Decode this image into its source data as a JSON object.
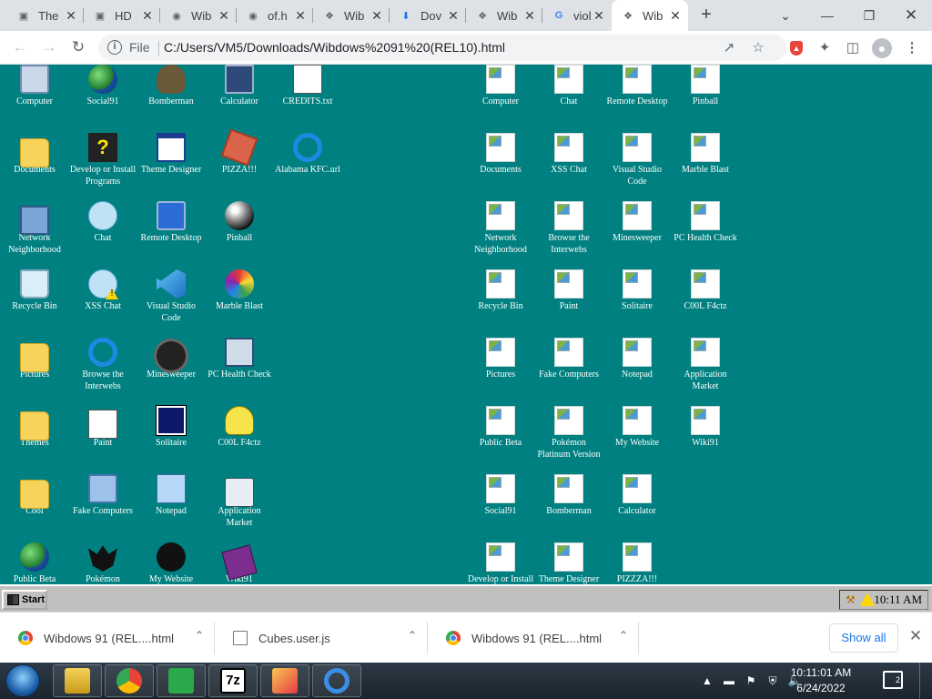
{
  "browser": {
    "tabs": [
      {
        "title": "The",
        "favicon": "film-icon"
      },
      {
        "title": "HD",
        "favicon": "film-icon"
      },
      {
        "title": "Wib",
        "favicon": "globe-icon"
      },
      {
        "title": "of.h",
        "favicon": "globe-icon"
      },
      {
        "title": "Wib",
        "favicon": "wibdows-icon"
      },
      {
        "title": "Dov",
        "favicon": "download-icon"
      },
      {
        "title": "Wib",
        "favicon": "wibdows-icon"
      },
      {
        "title": "viol",
        "favicon": "google-icon"
      },
      {
        "title": "Wib",
        "favicon": "wibdows-icon",
        "active": true
      }
    ],
    "file_label": "File",
    "url": "C:/Users/VM5/Downloads/Wibdows%2091%20(REL10).html"
  },
  "desktop": {
    "background": "#008080",
    "icons_left": [
      {
        "label": "Computer",
        "glyph": "pc"
      },
      {
        "label": "Social91",
        "glyph": "globe"
      },
      {
        "label": "Bomberman",
        "glyph": "bomber"
      },
      {
        "label": "Calculator",
        "glyph": "calc"
      },
      {
        "label": "CREDITS.txt",
        "glyph": "doc"
      },
      {
        "label": "Documents",
        "glyph": "folder"
      },
      {
        "label": "Develop or Install Programs",
        "glyph": "help"
      },
      {
        "label": "Theme Designer",
        "glyph": "win"
      },
      {
        "label": "PIZZA!!!",
        "glyph": "pizza"
      },
      {
        "label": "Alabama KFC.url",
        "glyph": "ie"
      },
      {
        "label": "Network Neighborhood",
        "glyph": "net"
      },
      {
        "label": "Chat",
        "glyph": "bubble"
      },
      {
        "label": "Remote Desktop",
        "glyph": "remote"
      },
      {
        "label": "Pinball",
        "glyph": "ball"
      },
      {
        "label": "Recycle Bin",
        "glyph": "bin"
      },
      {
        "label": "XSS Chat",
        "glyph": "xss"
      },
      {
        "label": "Visual Studio Code",
        "glyph": "vscode"
      },
      {
        "label": "Marble Blast",
        "glyph": "rainbow"
      },
      {
        "label": "Pictures",
        "glyph": "folder"
      },
      {
        "label": "Browse the Interwebs",
        "glyph": "ie"
      },
      {
        "label": "Minesweeper",
        "glyph": "mine"
      },
      {
        "label": "PC Health Check",
        "glyph": "pchealth"
      },
      {
        "label": "Themes",
        "glyph": "folder"
      },
      {
        "label": "Paint",
        "glyph": "paint"
      },
      {
        "label": "Solitaire",
        "glyph": "cards"
      },
      {
        "label": "C00L F4ctz",
        "glyph": "yellow"
      },
      {
        "label": "Cool",
        "glyph": "folder"
      },
      {
        "label": "Fake Computers",
        "glyph": "fakepc"
      },
      {
        "label": "Notepad",
        "glyph": "note"
      },
      {
        "label": "Application Market",
        "glyph": "bag"
      },
      {
        "label": "Public Beta",
        "glyph": "globe"
      },
      {
        "label": "Pokémon Platinum",
        "glyph": "bat"
      },
      {
        "label": "My Website",
        "glyph": "octo"
      },
      {
        "label": "Wiki91",
        "glyph": "book"
      }
    ],
    "icons_right": [
      "Computer",
      "Chat",
      "Remote Desktop",
      "Pinball",
      "Documents",
      "XSS Chat",
      "Visual Studio Code",
      "Marble Blast",
      "Network Neighborhood",
      "Browse the Interwebs",
      "Minesweeper",
      "PC Health Check",
      "Recycle Bin",
      "Paint",
      "Solitaire",
      "C00L F4ctz",
      "Pictures",
      "Fake Computers",
      "Notepad",
      "Application Market",
      "Public Beta",
      "Pokémon Platinum Version",
      "My Website",
      "Wiki91",
      "Social91",
      "Bomberman",
      "Calculator",
      "Develop or Install",
      "Theme Designer",
      "PIZZZA!!!"
    ]
  },
  "wibdows_taskbar": {
    "start_label": "Start",
    "clock": "10:11 AM"
  },
  "downloads": {
    "items": [
      {
        "name": "Wibdows 91 (REL....html",
        "icon": "chrome-icon"
      },
      {
        "name": "Cubes.user.js",
        "icon": "script-file-icon"
      },
      {
        "name": "Wibdows 91 (REL....html",
        "icon": "chrome-icon"
      }
    ],
    "show_all": "Show all"
  },
  "win7": {
    "time": "10:11:01 AM",
    "date": "6/24/2022",
    "notification_count": "2",
    "pinned": [
      "explorer",
      "chrome",
      "checkmark-app",
      "7z",
      "media-app",
      "internet-explorer"
    ]
  }
}
